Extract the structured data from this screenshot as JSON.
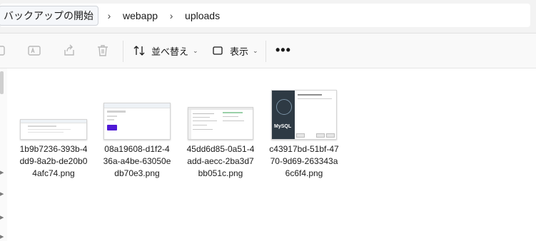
{
  "breadcrumb": {
    "items": [
      "バックアップの開始",
      "webapp",
      "uploads"
    ],
    "separator": "›"
  },
  "toolbar": {
    "sort_label": "並べ替え",
    "view_label": "表示",
    "more_label": "•••",
    "icons": [
      "new-icon",
      "rename-icon",
      "share-icon",
      "delete-icon",
      "sort-icon",
      "view-icon",
      "more-icon"
    ]
  },
  "files": [
    {
      "name": "1b9b7236-393b-4dd9-8a2b-de20b04afc74.png",
      "thumbnail": "browser-page-screenshot"
    },
    {
      "name": "08a19608-d1f2-436a-a4be-63050edb70e3.png",
      "thumbnail": "browser-page-with-purple-button"
    },
    {
      "name": "45dd6d85-0a51-4add-aecc-2ba3d7bb051c.png",
      "thumbnail": "code-editor-screenshot"
    },
    {
      "name": "c43917bd-51bf-4770-9d69-263343a6c6f4.png",
      "thumbnail": "mysql-installer-screenshot",
      "thumbnail_text": "MySQL"
    }
  ],
  "colors": {
    "accent": "#4f19d6",
    "mysql_dark": "#2e3a44",
    "toolbar_disabled": "#b9b9b9"
  }
}
